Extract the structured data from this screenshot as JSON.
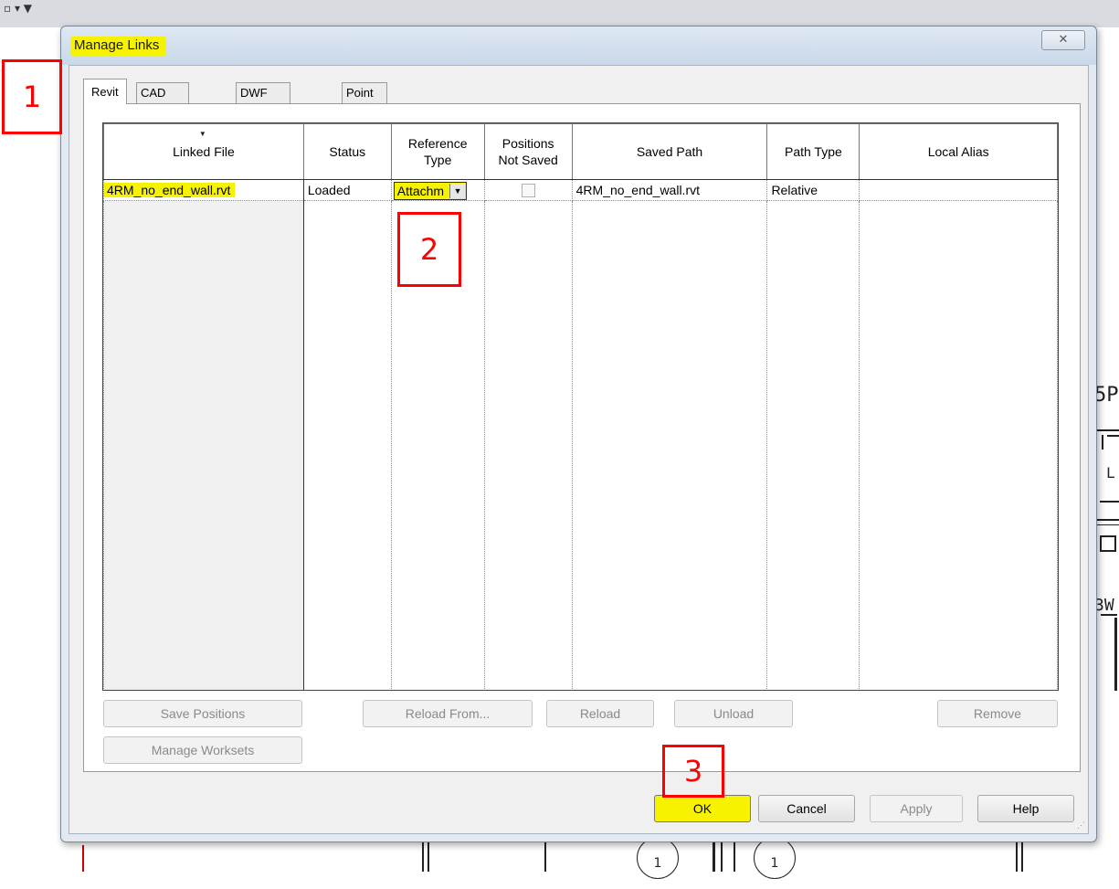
{
  "dialog": {
    "title": "Manage Links",
    "close_glyph": "✕"
  },
  "tabs": [
    {
      "label": "Revit",
      "active": true
    },
    {
      "label": "CAD Formats",
      "active": false
    },
    {
      "label": "DWF Markups",
      "active": false
    },
    {
      "label": "Point Clouds",
      "active": false
    }
  ],
  "table": {
    "sort_indicator": "▼",
    "columns": [
      "Linked File",
      "Status",
      "Reference Type",
      "Positions Not Saved",
      "Saved Path",
      "Path Type",
      "Local Alias"
    ],
    "column_lines": {
      "reference_type": [
        "Reference",
        "Type"
      ],
      "positions_not_saved": [
        "Positions",
        "Not Saved"
      ]
    },
    "rows": [
      {
        "linked_file": "4RM_no_end_wall.rvt",
        "status": "Loaded",
        "reference_type": "Attachm",
        "positions_not_saved": false,
        "saved_path": "4RM_no_end_wall.rvt",
        "path_type": "Relative",
        "local_alias": ""
      }
    ]
  },
  "buttons": {
    "save_positions": "Save Positions",
    "reload_from": "Reload From...",
    "reload": "Reload",
    "unload": "Unload",
    "remove": "Remove",
    "manage_worksets": "Manage Worksets",
    "ok": "OK",
    "cancel": "Cancel",
    "apply": "Apply",
    "help": "Help"
  },
  "annotations": {
    "marker_1": "1",
    "marker_2": "2",
    "marker_3": "3"
  },
  "background": {
    "toolbar_glyphs": "▫ ▾ ▼",
    "drawing_text_1": "5P",
    "drawing_text_2": "L",
    "drawing_text_3": "3W",
    "circle_label": "1"
  },
  "colors": {
    "highlight": "#f7f300",
    "marker_red": "#ff0000"
  }
}
